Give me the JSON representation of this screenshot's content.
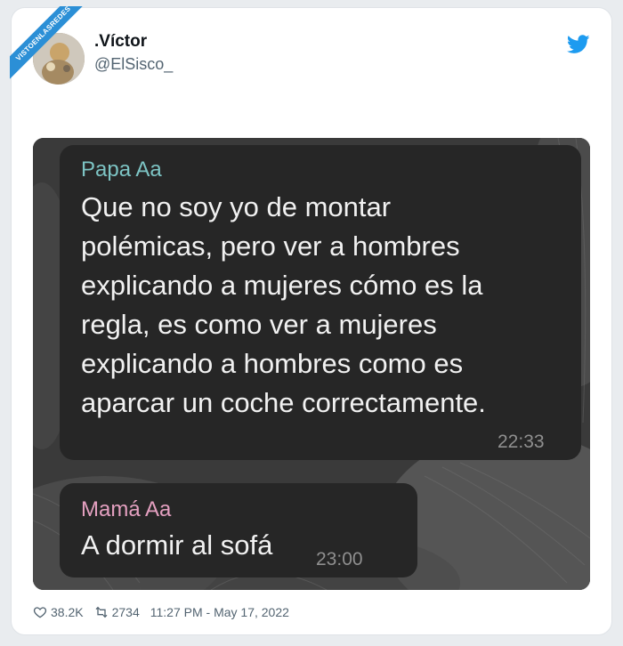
{
  "watermark": {
    "text": "VISTOENLASREDES"
  },
  "tweet": {
    "display_name": ".Víctor",
    "handle": "@ElSisco_",
    "likes": "38.2K",
    "retweets": "2734",
    "timestamp": "11:27 PM - May 17, 2022"
  },
  "chat": {
    "messages": [
      {
        "sender": "Papa Aa",
        "lines": [
          "Que no soy yo de montar",
          "polémicas, pero ver a hombres",
          "explicando a mujeres cómo es la",
          "regla, es como ver a mujeres",
          "explicando a hombres como es",
          "aparcar un coche correctamente."
        ],
        "time": "22:33"
      },
      {
        "sender": "Mamá Aa",
        "lines": [
          "A dormir al sofá"
        ],
        "time": "23:00"
      }
    ]
  },
  "icons": {
    "bird": "twitter-bird-icon",
    "like": "heart-icon",
    "retweet": "retweet-icon"
  },
  "colors": {
    "brand": "#1d9bf0",
    "sender1": "#7dc4c4",
    "sender2": "#e4a0c0",
    "bubble": "#262626"
  }
}
